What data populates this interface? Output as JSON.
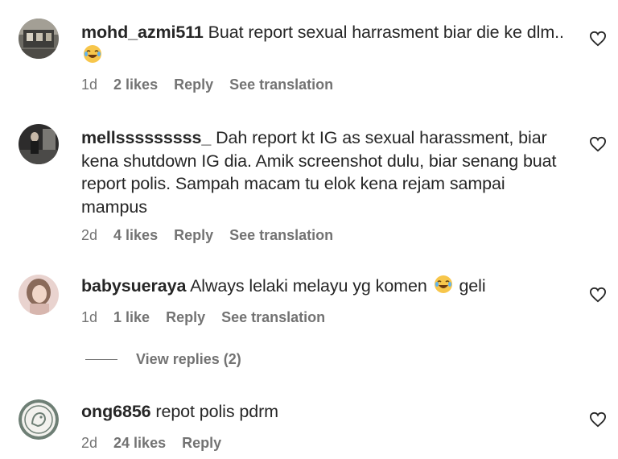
{
  "comments": [
    {
      "username": "mohd_azmi511",
      "text_before_emoji": "Buat report sexual harrasment biar die ke dlm..",
      "text_after_emoji": "",
      "time": "1d",
      "likes": "2 likes",
      "reply": "Reply",
      "translate": "See translation"
    },
    {
      "username": "mellsssssssss_",
      "text_before_emoji": "Dah report kt IG as sexual harassment, biar kena shutdown IG dia. Amik screenshot dulu, biar senang buat report polis. Sampah macam tu elok kena rejam sampai mampus",
      "text_after_emoji": "",
      "time": "2d",
      "likes": "4 likes",
      "reply": "Reply",
      "translate": "See translation"
    },
    {
      "username": "babysueraya",
      "text_before_emoji": "Always lelaki melayu yg komen",
      "text_after_emoji": "geli",
      "time": "1d",
      "likes": "1 like",
      "reply": "Reply",
      "translate": "See translation",
      "view_replies": "View replies (2)"
    },
    {
      "username": "ong6856",
      "text_before_emoji": "repot polis pdrm",
      "text_after_emoji": "",
      "time": "2d",
      "likes": "24 likes",
      "reply": "Reply"
    }
  ],
  "icons": {
    "emoji": "face-with-tears-of-joy-icon",
    "like": "heart-outline-icon"
  },
  "colors": {
    "text": "#262626",
    "secondary": "#737373",
    "emoji_yellow": "#f7c64b"
  }
}
